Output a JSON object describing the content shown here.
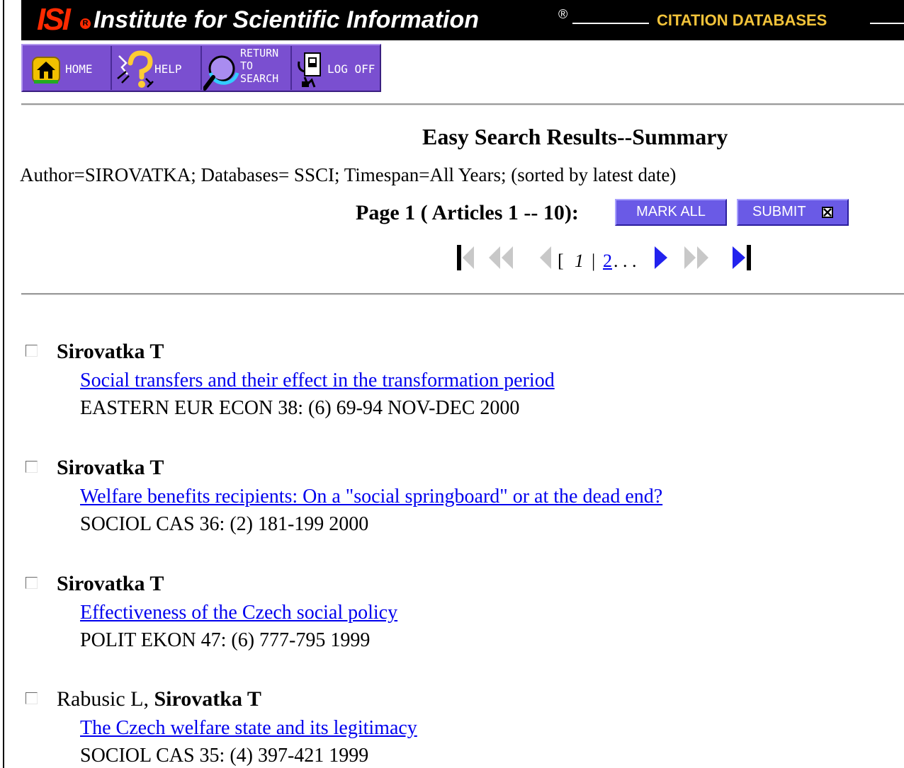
{
  "banner": {
    "logo_text": "ISI",
    "logo_mark": "R",
    "title": "Institute for Scientific Information",
    "registered": "®",
    "right_title": "CITATION DATABASES"
  },
  "nav": {
    "home": "HOME",
    "help": "HELP",
    "return_line1": "RETURN",
    "return_line2": "TO",
    "return_line3": "SEARCH",
    "logoff": "LOG OFF"
  },
  "page": {
    "title": "Easy Search Results--Summary",
    "query": "Author=SIROVATKA; Databases= SSCI; Timespan=All Years; (sorted by latest date)",
    "page_info": "Page 1 ( Articles 1 -- 10):",
    "mark_all": "MARK ALL",
    "submit": "SUBMIT"
  },
  "pager": {
    "open_bracket": "[",
    "current": "1",
    "separator": "|",
    "next_page": "2",
    "ellipsis": ". . ."
  },
  "records": [
    {
      "coauthors": "",
      "author": "Sirovatka T",
      "title": "Social transfers and their effect in the transformation period",
      "source": "EASTERN EUR ECON 38: (6) 69-94 NOV-DEC 2000"
    },
    {
      "coauthors": "",
      "author": "Sirovatka T",
      "title": "Welfare benefits recipients: On a \"social springboard\" or at the dead end?",
      "source": "SOCIOL CAS 36: (2) 181-199 2000"
    },
    {
      "coauthors": "",
      "author": "Sirovatka T",
      "title": "Effectiveness of the Czech social policy",
      "source": "POLIT EKON 47: (6) 777-795 1999"
    },
    {
      "coauthors": "Rabusic L, ",
      "author": "Sirovatka T",
      "title": "The Czech welfare state and its legitimacy",
      "source": "SOCIOL CAS 35: (4) 397-421 1999"
    }
  ]
}
